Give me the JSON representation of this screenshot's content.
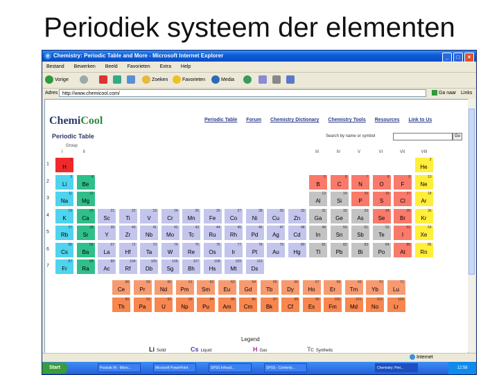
{
  "slide": {
    "title": "Periodiek systeem der elementen"
  },
  "window": {
    "title": "Chemistry: Periodic Table and More - Microsoft Internet Explorer",
    "buttons": [
      "_",
      "□",
      "×"
    ]
  },
  "menu": [
    "Bestand",
    "Bewerken",
    "Beeld",
    "Favorieten",
    "Extra",
    "Help"
  ],
  "toolbar": {
    "back": "Vorige",
    "search": "Zoeken",
    "favorites": "Favorieten",
    "media": "Media"
  },
  "address": {
    "label": "Adres",
    "url": "http://www.chemicool.com/",
    "go": "Ga naar",
    "links": "Links"
  },
  "site": {
    "logo_chemi": "Chemi",
    "logo_cool": "Cool",
    "heading": "Periodic Table",
    "nav": [
      "Periodic Table",
      "Forum",
      "Chemistry Dictionary",
      "Chemistry Tools",
      "Resources",
      "Link to Us"
    ],
    "search_label": "Search by name or symbol",
    "search_go": "Go"
  },
  "table": {
    "group_labels": [
      "Group",
      "I",
      "II",
      "III",
      "IV",
      "V",
      "VI",
      "VII",
      "VIII"
    ],
    "periods": [
      "1",
      "2",
      "3",
      "4",
      "5",
      "6",
      "7"
    ],
    "colors": {
      "nonmetal": "#f97a6a",
      "alkali": "#4fd3ee",
      "alkaline": "#2fbf8a",
      "transition": "#c3c5ec",
      "poor": "#c3c3c3",
      "noble": "#ffee3a",
      "halogen": "#f97a6a",
      "hydrogen": "#f02a2a",
      "lanthanide": "#f79a70",
      "actinide": "#f7864f"
    },
    "main": [
      {
        "z": "1",
        "sym": "H",
        "cat": "hydrogen",
        "col": 1,
        "row": 1
      },
      {
        "z": "2",
        "sym": "He",
        "cat": "noble",
        "col": 18,
        "row": 1
      },
      {
        "z": "3",
        "sym": "Li",
        "cat": "alkali",
        "col": 1,
        "row": 2
      },
      {
        "z": "4",
        "sym": "Be",
        "cat": "alkaline",
        "col": 2,
        "row": 2
      },
      {
        "z": "5",
        "sym": "B",
        "cat": "nonmetal",
        "col": 13,
        "row": 2
      },
      {
        "z": "6",
        "sym": "C",
        "cat": "nonmetal",
        "col": 14,
        "row": 2
      },
      {
        "z": "7",
        "sym": "N",
        "cat": "nonmetal",
        "col": 15,
        "row": 2
      },
      {
        "z": "8",
        "sym": "O",
        "cat": "nonmetal",
        "col": 16,
        "row": 2
      },
      {
        "z": "9",
        "sym": "F",
        "cat": "nonmetal",
        "col": 17,
        "row": 2
      },
      {
        "z": "10",
        "sym": "Ne",
        "cat": "noble",
        "col": 18,
        "row": 2
      },
      {
        "z": "11",
        "sym": "Na",
        "cat": "alkali",
        "col": 1,
        "row": 3
      },
      {
        "z": "12",
        "sym": "Mg",
        "cat": "alkaline",
        "col": 2,
        "row": 3
      },
      {
        "z": "13",
        "sym": "Al",
        "cat": "poor",
        "col": 13,
        "row": 3
      },
      {
        "z": "14",
        "sym": "Si",
        "cat": "poor",
        "col": 14,
        "row": 3
      },
      {
        "z": "15",
        "sym": "P",
        "cat": "nonmetal",
        "col": 15,
        "row": 3
      },
      {
        "z": "16",
        "sym": "S",
        "cat": "nonmetal",
        "col": 16,
        "row": 3
      },
      {
        "z": "17",
        "sym": "Cl",
        "cat": "nonmetal",
        "col": 17,
        "row": 3
      },
      {
        "z": "18",
        "sym": "Ar",
        "cat": "noble",
        "col": 18,
        "row": 3
      },
      {
        "z": "19",
        "sym": "K",
        "cat": "alkali",
        "col": 1,
        "row": 4
      },
      {
        "z": "20",
        "sym": "Ca",
        "cat": "alkaline",
        "col": 2,
        "row": 4
      },
      {
        "z": "21",
        "sym": "Sc",
        "cat": "transition",
        "col": 3,
        "row": 4
      },
      {
        "z": "22",
        "sym": "Ti",
        "cat": "transition",
        "col": 4,
        "row": 4
      },
      {
        "z": "23",
        "sym": "V",
        "cat": "transition",
        "col": 5,
        "row": 4
      },
      {
        "z": "24",
        "sym": "Cr",
        "cat": "transition",
        "col": 6,
        "row": 4
      },
      {
        "z": "25",
        "sym": "Mn",
        "cat": "transition",
        "col": 7,
        "row": 4
      },
      {
        "z": "26",
        "sym": "Fe",
        "cat": "transition",
        "col": 8,
        "row": 4
      },
      {
        "z": "27",
        "sym": "Co",
        "cat": "transition",
        "col": 9,
        "row": 4
      },
      {
        "z": "28",
        "sym": "Ni",
        "cat": "transition",
        "col": 10,
        "row": 4
      },
      {
        "z": "29",
        "sym": "Cu",
        "cat": "transition",
        "col": 11,
        "row": 4
      },
      {
        "z": "30",
        "sym": "Zn",
        "cat": "transition",
        "col": 12,
        "row": 4
      },
      {
        "z": "31",
        "sym": "Ga",
        "cat": "poor",
        "col": 13,
        "row": 4
      },
      {
        "z": "32",
        "sym": "Ge",
        "cat": "poor",
        "col": 14,
        "row": 4
      },
      {
        "z": "33",
        "sym": "As",
        "cat": "poor",
        "col": 15,
        "row": 4
      },
      {
        "z": "34",
        "sym": "Se",
        "cat": "nonmetal",
        "col": 16,
        "row": 4
      },
      {
        "z": "35",
        "sym": "Br",
        "cat": "nonmetal",
        "col": 17,
        "row": 4
      },
      {
        "z": "36",
        "sym": "Kr",
        "cat": "noble",
        "col": 18,
        "row": 4
      },
      {
        "z": "37",
        "sym": "Rb",
        "cat": "alkali",
        "col": 1,
        "row": 5
      },
      {
        "z": "38",
        "sym": "Sr",
        "cat": "alkaline",
        "col": 2,
        "row": 5
      },
      {
        "z": "39",
        "sym": "Y",
        "cat": "transition",
        "col": 3,
        "row": 5
      },
      {
        "z": "40",
        "sym": "Zr",
        "cat": "transition",
        "col": 4,
        "row": 5
      },
      {
        "z": "41",
        "sym": "Nb",
        "cat": "transition",
        "col": 5,
        "row": 5
      },
      {
        "z": "42",
        "sym": "Mo",
        "cat": "transition",
        "col": 6,
        "row": 5
      },
      {
        "z": "43",
        "sym": "Tc",
        "cat": "transition",
        "col": 7,
        "row": 5
      },
      {
        "z": "44",
        "sym": "Ru",
        "cat": "transition",
        "col": 8,
        "row": 5
      },
      {
        "z": "45",
        "sym": "Rh",
        "cat": "transition",
        "col": 9,
        "row": 5
      },
      {
        "z": "46",
        "sym": "Pd",
        "cat": "transition",
        "col": 10,
        "row": 5
      },
      {
        "z": "47",
        "sym": "Ag",
        "cat": "transition",
        "col": 11,
        "row": 5
      },
      {
        "z": "48",
        "sym": "Cd",
        "cat": "transition",
        "col": 12,
        "row": 5
      },
      {
        "z": "49",
        "sym": "In",
        "cat": "poor",
        "col": 13,
        "row": 5
      },
      {
        "z": "50",
        "sym": "Sn",
        "cat": "poor",
        "col": 14,
        "row": 5
      },
      {
        "z": "51",
        "sym": "Sb",
        "cat": "poor",
        "col": 15,
        "row": 5
      },
      {
        "z": "52",
        "sym": "Te",
        "cat": "poor",
        "col": 16,
        "row": 5
      },
      {
        "z": "53",
        "sym": "I",
        "cat": "nonmetal",
        "col": 17,
        "row": 5
      },
      {
        "z": "54",
        "sym": "Xe",
        "cat": "noble",
        "col": 18,
        "row": 5
      },
      {
        "z": "55",
        "sym": "Cs",
        "cat": "alkali",
        "col": 1,
        "row": 6
      },
      {
        "z": "56",
        "sym": "Ba",
        "cat": "alkaline",
        "col": 2,
        "row": 6
      },
      {
        "z": "57",
        "sym": "La",
        "cat": "transition",
        "col": 3,
        "row": 6
      },
      {
        "z": "72",
        "sym": "Hf",
        "cat": "transition",
        "col": 4,
        "row": 6
      },
      {
        "z": "73",
        "sym": "Ta",
        "cat": "transition",
        "col": 5,
        "row": 6
      },
      {
        "z": "74",
        "sym": "W",
        "cat": "transition",
        "col": 6,
        "row": 6
      },
      {
        "z": "75",
        "sym": "Re",
        "cat": "transition",
        "col": 7,
        "row": 6
      },
      {
        "z": "76",
        "sym": "Os",
        "cat": "transition",
        "col": 8,
        "row": 6
      },
      {
        "z": "77",
        "sym": "Ir",
        "cat": "transition",
        "col": 9,
        "row": 6
      },
      {
        "z": "78",
        "sym": "Pt",
        "cat": "transition",
        "col": 10,
        "row": 6
      },
      {
        "z": "79",
        "sym": "Au",
        "cat": "transition",
        "col": 11,
        "row": 6
      },
      {
        "z": "80",
        "sym": "Hg",
        "cat": "transition",
        "col": 12,
        "row": 6
      },
      {
        "z": "81",
        "sym": "Tl",
        "cat": "poor",
        "col": 13,
        "row": 6
      },
      {
        "z": "82",
        "sym": "Pb",
        "cat": "poor",
        "col": 14,
        "row": 6
      },
      {
        "z": "83",
        "sym": "Bi",
        "cat": "poor",
        "col": 15,
        "row": 6
      },
      {
        "z": "84",
        "sym": "Po",
        "cat": "poor",
        "col": 16,
        "row": 6
      },
      {
        "z": "85",
        "sym": "At",
        "cat": "nonmetal",
        "col": 17,
        "row": 6
      },
      {
        "z": "86",
        "sym": "Rn",
        "cat": "noble",
        "col": 18,
        "row": 6
      },
      {
        "z": "87",
        "sym": "Fr",
        "cat": "alkali",
        "col": 1,
        "row": 7
      },
      {
        "z": "88",
        "sym": "Ra",
        "cat": "alkaline",
        "col": 2,
        "row": 7
      },
      {
        "z": "89",
        "sym": "Ac",
        "cat": "transition",
        "col": 3,
        "row": 7
      },
      {
        "z": "104",
        "sym": "Rf",
        "cat": "transition",
        "col": 4,
        "row": 7
      },
      {
        "z": "105",
        "sym": "Db",
        "cat": "transition",
        "col": 5,
        "row": 7
      },
      {
        "z": "106",
        "sym": "Sg",
        "cat": "transition",
        "col": 6,
        "row": 7
      },
      {
        "z": "107",
        "sym": "Bh",
        "cat": "transition",
        "col": 7,
        "row": 7
      },
      {
        "z": "108",
        "sym": "Hs",
        "cat": "transition",
        "col": 8,
        "row": 7
      },
      {
        "z": "109",
        "sym": "Mt",
        "cat": "transition",
        "col": 9,
        "row": 7
      },
      {
        "z": "110",
        "sym": "Ds",
        "cat": "transition",
        "col": 10,
        "row": 7
      }
    ],
    "lanthanides": [
      {
        "z": "58",
        "sym": "Ce"
      },
      {
        "z": "59",
        "sym": "Pr"
      },
      {
        "z": "60",
        "sym": "Nd"
      },
      {
        "z": "61",
        "sym": "Pm"
      },
      {
        "z": "62",
        "sym": "Sm"
      },
      {
        "z": "63",
        "sym": "Eu"
      },
      {
        "z": "64",
        "sym": "Gd"
      },
      {
        "z": "65",
        "sym": "Tb"
      },
      {
        "z": "66",
        "sym": "Dy"
      },
      {
        "z": "67",
        "sym": "Ho"
      },
      {
        "z": "68",
        "sym": "Er"
      },
      {
        "z": "69",
        "sym": "Tm"
      },
      {
        "z": "70",
        "sym": "Yb"
      },
      {
        "z": "71",
        "sym": "Lu"
      }
    ],
    "actinides": [
      {
        "z": "90",
        "sym": "Th"
      },
      {
        "z": "91",
        "sym": "Pa"
      },
      {
        "z": "92",
        "sym": "U"
      },
      {
        "z": "93",
        "sym": "Np"
      },
      {
        "z": "94",
        "sym": "Pu"
      },
      {
        "z": "95",
        "sym": "Am"
      },
      {
        "z": "96",
        "sym": "Cm"
      },
      {
        "z": "97",
        "sym": "Bk"
      },
      {
        "z": "98",
        "sym": "Cf"
      },
      {
        "z": "99",
        "sym": "Es"
      },
      {
        "z": "100",
        "sym": "Fm"
      },
      {
        "z": "101",
        "sym": "Md"
      },
      {
        "z": "102",
        "sym": "No"
      },
      {
        "z": "103",
        "sym": "Lr"
      }
    ]
  },
  "legend": {
    "title": "Legend",
    "items": [
      {
        "sym": "Li",
        "label": "Solid",
        "color": "#222222"
      },
      {
        "sym": "Cs",
        "label": "Liquid",
        "color": "#5533aa"
      },
      {
        "sym": "H",
        "label": "Gas",
        "color": "#aa3399"
      },
      {
        "sym": "Tc",
        "label": "Synthetic",
        "color": "#888888"
      }
    ]
  },
  "status": {
    "right": "Internet"
  },
  "taskbar": {
    "start": "Start",
    "tasks": [
      "Postvak IN - Micro...",
      "Microsoft PowerPoint",
      "SPSS Inhoud...",
      "SPSS - Contents...",
      "Chemistry: Peri..."
    ],
    "clock": "12:58"
  }
}
